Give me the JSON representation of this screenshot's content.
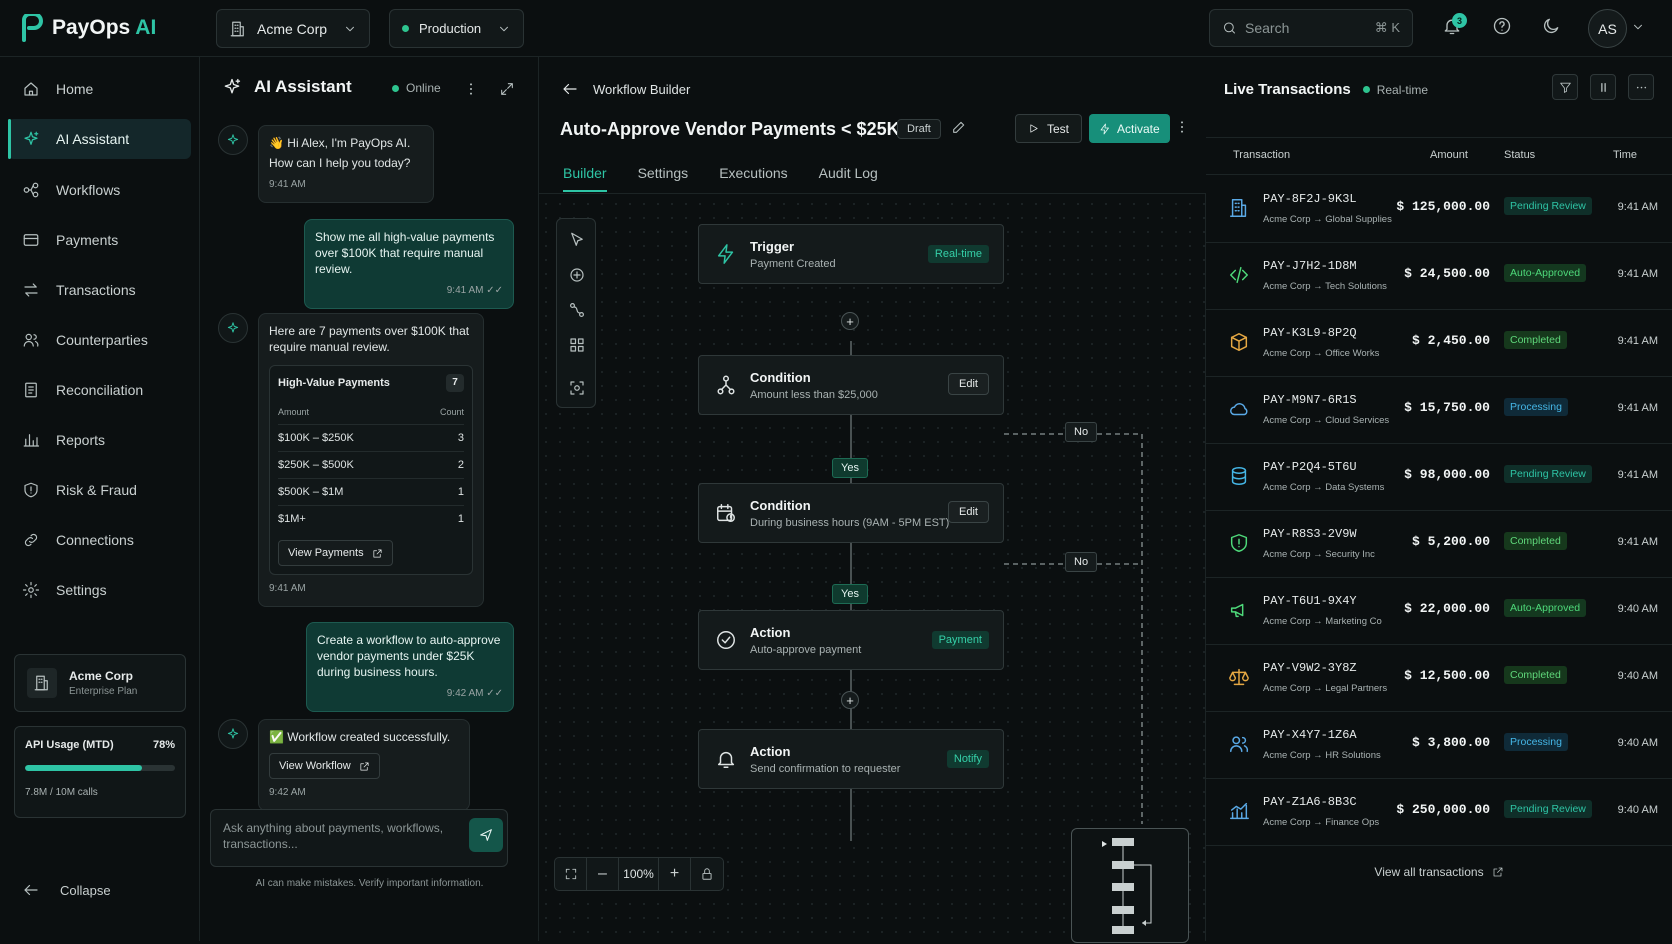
{
  "brand": {
    "name": "PayOps",
    "ai": "AI",
    "accent": "#2ec4a5"
  },
  "topbar": {
    "org": "Acme Corp",
    "env": "Production",
    "search_placeholder": "Search",
    "search_shortcut": "⌘ K",
    "notification_count": "3",
    "avatar_initials": "AS"
  },
  "sidebar": {
    "items": [
      {
        "label": "Home",
        "icon": "home-icon"
      },
      {
        "label": "AI Assistant",
        "icon": "sparkle-icon",
        "active": true
      },
      {
        "label": "Workflows",
        "icon": "workflow-icon"
      },
      {
        "label": "Payments",
        "icon": "card-icon"
      },
      {
        "label": "Transactions",
        "icon": "arrows-icon"
      },
      {
        "label": "Counterparties",
        "icon": "users-icon"
      },
      {
        "label": "Reconciliation",
        "icon": "ledger-icon"
      },
      {
        "label": "Reports",
        "icon": "chart-icon"
      },
      {
        "label": "Risk & Fraud",
        "icon": "shield-icon"
      },
      {
        "label": "Connections",
        "icon": "link-icon"
      },
      {
        "label": "Settings",
        "icon": "gear-icon"
      }
    ],
    "org_card": {
      "name": "Acme Corp",
      "plan": "Enterprise Plan"
    },
    "usage": {
      "label": "API Usage (MTD)",
      "percent_label": "78%",
      "fraction": 0.78,
      "calls": "7.8M / 10M calls"
    },
    "collapse": "Collapse"
  },
  "assistant": {
    "title": "AI Assistant",
    "status": "Online",
    "messages": [
      {
        "who": "ai",
        "line1": "👋 Hi Alex, I'm PayOps AI.",
        "line2": "How can I help you today?",
        "time": "9:41 AM"
      },
      {
        "who": "user",
        "text": "Show me all high-value payments over $100K that require manual review.",
        "time": "9:41 AM"
      },
      {
        "who": "ai",
        "text": "Here are 7 payments over $100K that require manual review.",
        "time": "9:41 AM"
      },
      {
        "who": "user",
        "text": "Create a workflow to auto-approve vendor payments under $25K during business hours.",
        "time": "9:42 AM"
      },
      {
        "who": "ai",
        "text": "✅ Workflow created successfully.",
        "time": "9:42 AM"
      }
    ],
    "hv_card": {
      "title": "High-Value Payments",
      "count": "7",
      "col_amount": "Amount",
      "col_count": "Count",
      "rows": [
        {
          "range": "$100K – $250K",
          "count": "3"
        },
        {
          "range": "$250K – $500K",
          "count": "2"
        },
        {
          "range": "$500K – $1M",
          "count": "1"
        },
        {
          "range": "$1M+",
          "count": "1"
        }
      ],
      "button": "View Payments"
    },
    "view_workflow": "View Workflow",
    "composer_placeholder": "Ask anything about payments, workflows, transactions...",
    "disclaimer": "AI can make mistakes. Verify important information."
  },
  "workflow": {
    "crumb": "Workflow Builder",
    "title": "Auto-Approve Vendor Payments < $25K",
    "status": "Draft",
    "test": "Test",
    "activate": "Activate",
    "tabs": [
      "Builder",
      "Settings",
      "Executions",
      "Audit Log"
    ],
    "nodes": [
      {
        "title": "Trigger",
        "sub": "Payment Created",
        "pill": "Real-time"
      },
      {
        "title": "Condition",
        "sub": "Amount less than $25,000",
        "edit": "Edit"
      },
      {
        "title": "Condition",
        "sub": "During business hours (9AM - 5PM EST)",
        "edit": "Edit"
      },
      {
        "title": "Action",
        "sub": "Auto-approve payment",
        "pill": "Payment"
      },
      {
        "title": "Action",
        "sub": "Send confirmation to requester",
        "pill": "Notify"
      }
    ],
    "yes": "Yes",
    "no": "No",
    "zoom": "100%"
  },
  "transactions": {
    "title": "Live Transactions",
    "realtime": "Real-time",
    "cols": {
      "tx": "Transaction",
      "amount": "Amount",
      "status": "Status",
      "time": "Time"
    },
    "rows": [
      {
        "id": "PAY-8F2J-9K3L",
        "path": "Acme Corp → Global Supplies",
        "amount": "$ 125,000.00",
        "status": "Pending Review",
        "kind": "pending",
        "time": "9:41 AM",
        "icon": "building-icon",
        "color": "#5aa9e6"
      },
      {
        "id": "PAY-J7H2-1D8M",
        "path": "Acme Corp → Tech Solutions",
        "amount": "$ 24,500.00",
        "status": "Auto-Approved",
        "kind": "auto",
        "time": "9:41 AM",
        "icon": "code-icon",
        "color": "#4ed97a"
      },
      {
        "id": "PAY-K3L9-8P2Q",
        "path": "Acme Corp → Office Works",
        "amount": "$ 2,450.00",
        "status": "Completed",
        "kind": "done",
        "time": "9:41 AM",
        "icon": "box-icon",
        "color": "#e6a843"
      },
      {
        "id": "PAY-M9N7-6R1S",
        "path": "Acme Corp → Cloud Services",
        "amount": "$ 15,750.00",
        "status": "Processing",
        "kind": "proc",
        "time": "9:41 AM",
        "icon": "cloud-icon",
        "color": "#5aa9e6"
      },
      {
        "id": "PAY-P2Q4-5T6U",
        "path": "Acme Corp → Data Systems",
        "amount": "$ 98,000.00",
        "status": "Pending Review",
        "kind": "pending",
        "time": "9:41 AM",
        "icon": "database-icon",
        "color": "#45b6e6"
      },
      {
        "id": "PAY-R8S3-2V9W",
        "path": "Acme Corp → Security Inc",
        "amount": "$ 5,200.00",
        "status": "Completed",
        "kind": "done",
        "time": "9:41 AM",
        "icon": "shield-icon",
        "color": "#4ed97a"
      },
      {
        "id": "PAY-T6U1-9X4Y",
        "path": "Acme Corp → Marketing Co",
        "amount": "$ 22,000.00",
        "status": "Auto-Approved",
        "kind": "auto",
        "time": "9:40 AM",
        "icon": "megaphone-icon",
        "color": "#4ed97a"
      },
      {
        "id": "PAY-V9W2-3Y8Z",
        "path": "Acme Corp → Legal Partners",
        "amount": "$ 12,500.00",
        "status": "Completed",
        "kind": "done",
        "time": "9:40 AM",
        "icon": "scale-icon",
        "color": "#e6a843"
      },
      {
        "id": "PAY-X4Y7-1Z6A",
        "path": "Acme Corp → HR Solutions",
        "amount": "$ 3,800.00",
        "status": "Processing",
        "kind": "proc",
        "time": "9:40 AM",
        "icon": "users-icon",
        "color": "#5aa9e6"
      },
      {
        "id": "PAY-Z1A6-8B3C",
        "path": "Acme Corp → Finance Ops",
        "amount": "$ 250,000.00",
        "status": "Pending Review",
        "kind": "pending",
        "time": "9:40 AM",
        "icon": "chart-icon",
        "color": "#5aa9e6"
      }
    ],
    "view_all": "View all transactions"
  }
}
